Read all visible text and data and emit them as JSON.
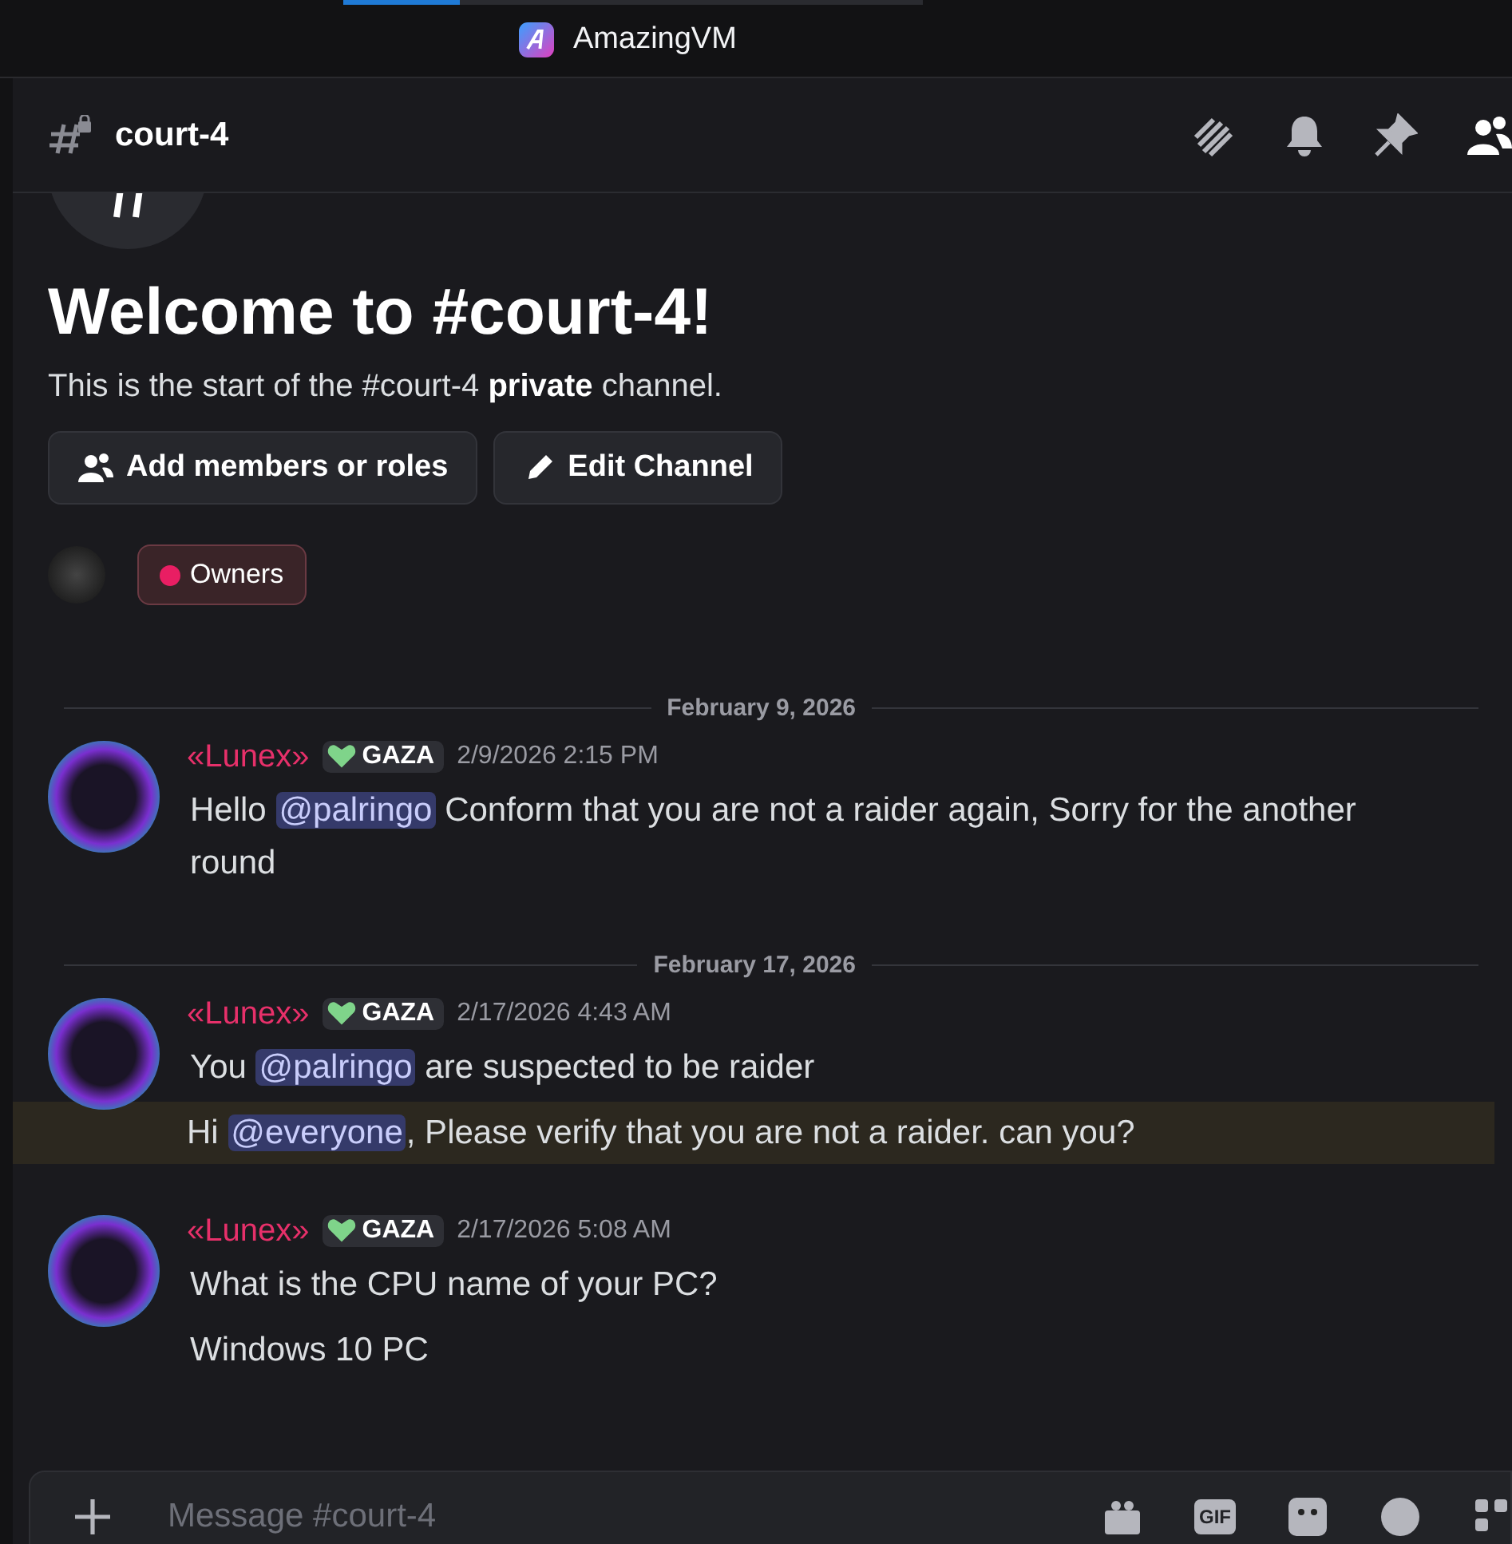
{
  "titlebar": {
    "tabs": [
      {
        "selected": true
      },
      {
        "selected": false
      }
    ],
    "app_name": "AmazingVM"
  },
  "header": {
    "channel": "court-4",
    "private": true
  },
  "welcome": {
    "title": "Welcome to #court-4!",
    "subtitle": "This is the start of the #court-4 **private** channel.",
    "buttons": [
      {
        "label": "Add members or roles",
        "kind": "members"
      },
      {
        "label": "Edit Channel",
        "kind": "edit"
      }
    ],
    "role": {
      "name": "Owners",
      "color": "#e91e63"
    }
  },
  "feed": [
    {
      "kind": "divider",
      "date": "February 9, 2026"
    },
    {
      "kind": "message",
      "author": "«Lunex»",
      "tag": "GAZA",
      "time": "2/9/2026 2:15 PM",
      "lines": [
        {
          "highlighted": false,
          "parts": [
            {
              "kind": "text",
              "text": "Hello "
            },
            {
              "kind": "mention",
              "text": "@palringo"
            },
            {
              "kind": "text",
              "text": " Conform that you are not a raider again, Sorry for the another round"
            }
          ]
        }
      ]
    },
    {
      "kind": "divider",
      "date": "February 17, 2026"
    },
    {
      "kind": "message",
      "author": "«Lunex»",
      "tag": "GAZA",
      "time": "2/17/2026 4:43 AM",
      "lines": [
        {
          "highlighted": false,
          "parts": [
            {
              "kind": "text",
              "text": "You "
            },
            {
              "kind": "mention",
              "text": "@palringo"
            },
            {
              "kind": "text",
              "text": " are suspected to be raider"
            }
          ]
        },
        {
          "highlighted": true,
          "parts": [
            {
              "kind": "text",
              "text": "Hi "
            },
            {
              "kind": "mention",
              "text": "@everyone"
            },
            {
              "kind": "text",
              "text": ", Please verify that you are not a raider. can you?"
            }
          ]
        }
      ]
    },
    {
      "kind": "message",
      "author": "«Lunex»",
      "tag": "GAZA",
      "time": "2/17/2026 5:08 AM",
      "lines": [
        {
          "highlighted": false,
          "parts": [
            {
              "kind": "text",
              "text": "What is the CPU name of your PC?"
            }
          ]
        },
        {
          "highlighted": false,
          "parts": [
            {
              "kind": "text",
              "text": "Windows 10 PC"
            }
          ]
        }
      ]
    }
  ],
  "composer": {
    "placeholder": "Message #court-4",
    "gif_label": "GIF"
  }
}
